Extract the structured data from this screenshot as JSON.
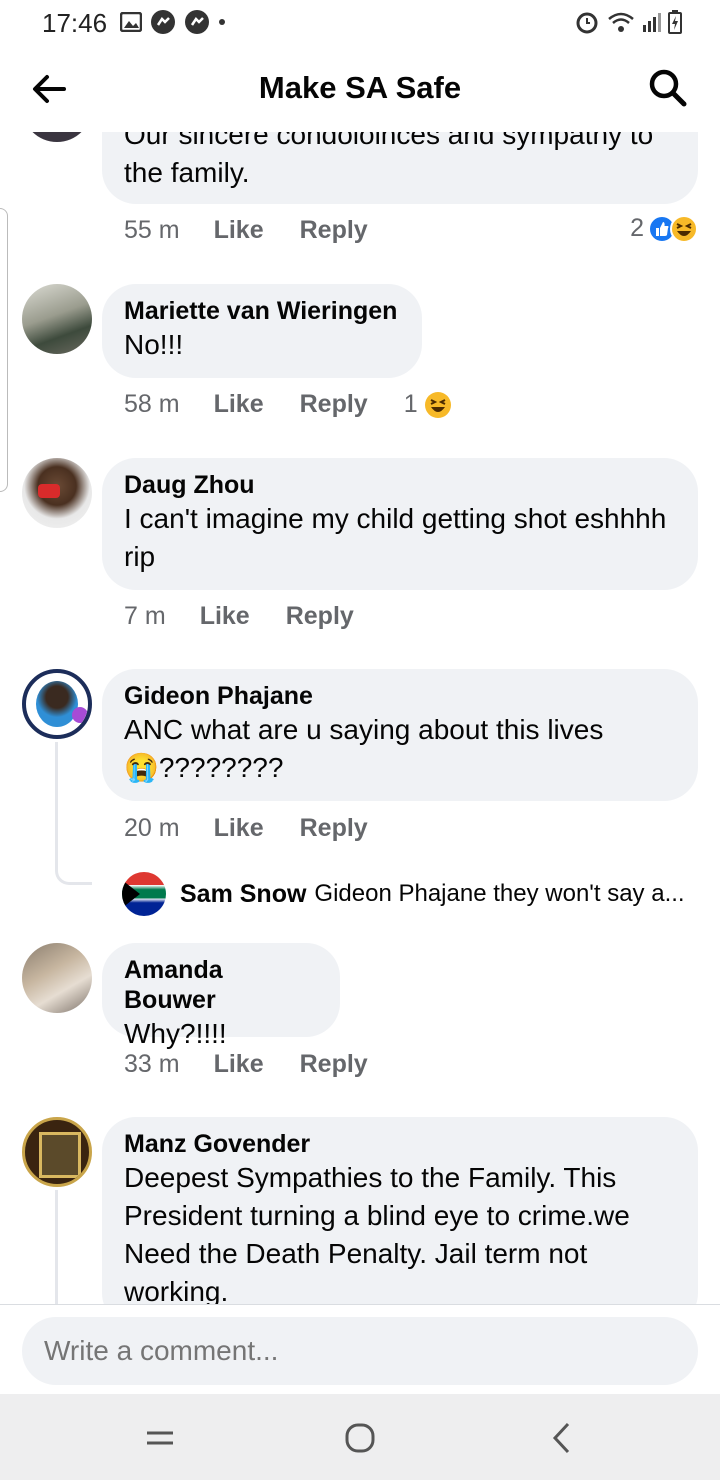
{
  "status_bar": {
    "time": "17:46"
  },
  "header": {
    "title": "Make SA Safe"
  },
  "comments": [
    {
      "author": "",
      "text": "Our sincere condoloinces and sympathy to the family.",
      "time": "55 m",
      "like": "Like",
      "reply": "Reply",
      "reaction_count": "2"
    },
    {
      "author": "Mariette van Wieringen",
      "text": "No!!!",
      "time": "58 m",
      "like": "Like",
      "reply": "Reply",
      "reaction_count": "1"
    },
    {
      "author": "Daug Zhou",
      "text": "I can't imagine my child getting shot eshhhh rip",
      "time": "7 m",
      "like": "Like",
      "reply": "Reply"
    },
    {
      "author": "Gideon Phajane",
      "text": "ANC what are u saying about this lives 😭????????",
      "time": "20 m",
      "like": "Like",
      "reply": "Reply",
      "reply_preview": {
        "author": "Sam Snow",
        "text": "Gideon Phajane they won't say a..."
      }
    },
    {
      "author": "Amanda Bouwer",
      "text": "Why?!!!!",
      "time": "33 m",
      "like": "Like",
      "reply": "Reply"
    },
    {
      "author": "Manz Govender",
      "text": "Deepest Sympathies to the Family. This President turning a blind eye to crime.we Need the Death Penalty. Jail term not working."
    }
  ],
  "composer": {
    "placeholder": "Write a comment..."
  },
  "icons": [
    "back-arrow-icon",
    "search-icon",
    "like-reaction-icon",
    "haha-reaction-icon",
    "recent-apps-icon",
    "home-icon",
    "back-nav-icon"
  ],
  "colors": {
    "bubble": "#f0f2f5",
    "meta": "#65676b",
    "like_blue": "#1877f2",
    "haha_yellow": "#f7b928"
  }
}
